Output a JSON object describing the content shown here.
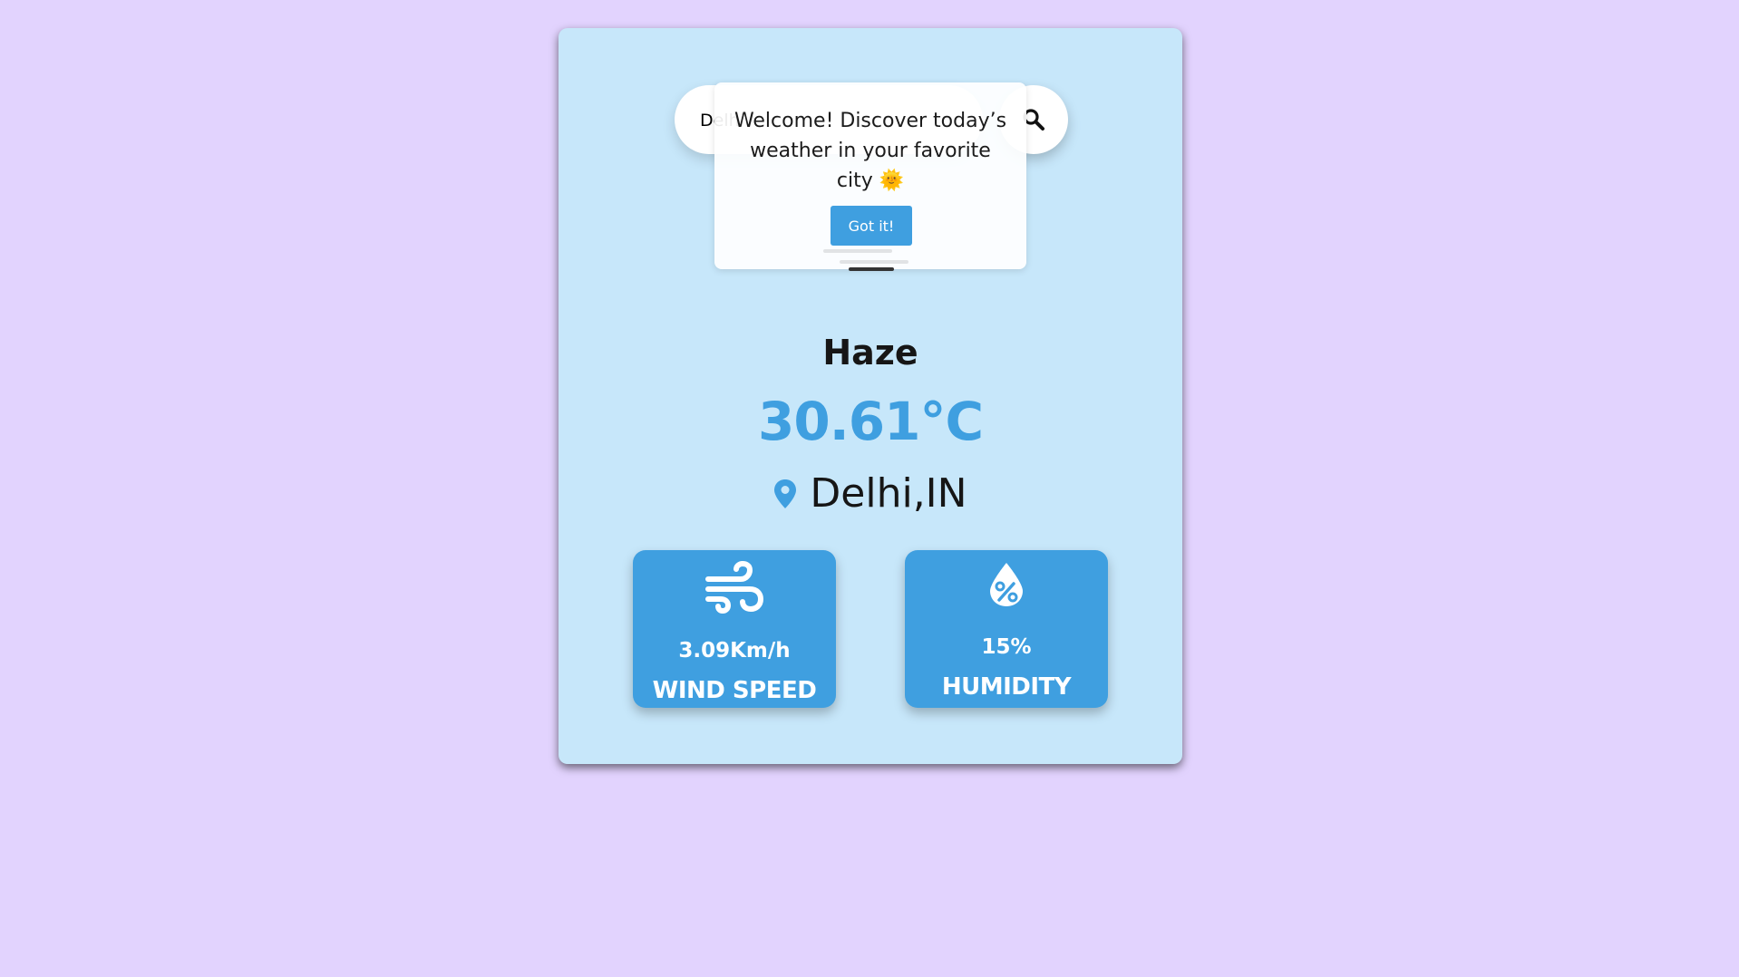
{
  "search": {
    "value": "Delhi",
    "button_icon": "search-icon"
  },
  "popup": {
    "message": "Welcome! Discover today’s weather in your favorite city 🌞",
    "button_label": "Got it!"
  },
  "weather": {
    "condition": "Haze",
    "temperature": "30.61°C",
    "location": "Delhi,IN",
    "location_icon": "map-pin-icon"
  },
  "stats": {
    "wind": {
      "value": "3.09Km/h",
      "label": "WIND SPEED",
      "icon": "wind-icon"
    },
    "humidity": {
      "value": "15%",
      "label": "HUMIDITY",
      "icon": "humidity-drop-icon"
    }
  },
  "colors": {
    "page_background": "#e2d3fe",
    "card_background": "#c7e7fa",
    "accent": "#3f9fe0",
    "text": "#161616"
  }
}
